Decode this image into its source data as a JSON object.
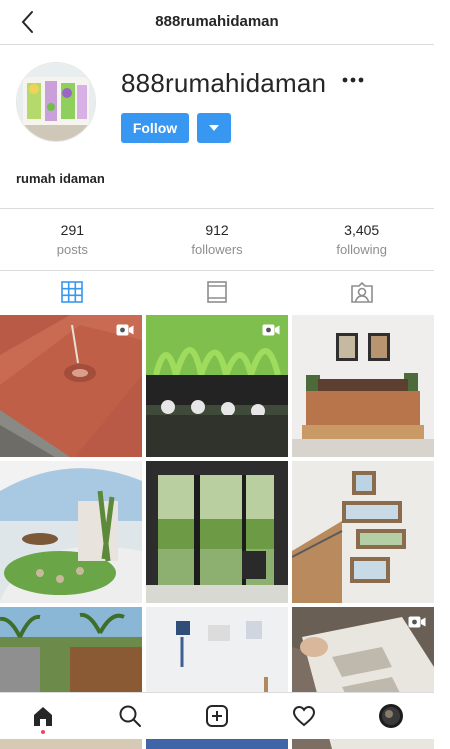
{
  "header": {
    "title": "888rumahidaman"
  },
  "profile": {
    "username": "888rumahidaman",
    "follow_label": "Follow",
    "bio": "rumah idaman"
  },
  "stats": {
    "posts": {
      "value": "291",
      "label": "posts"
    },
    "followers": {
      "value": "912",
      "label": "followers"
    },
    "following": {
      "value": "3,405",
      "label": "following"
    }
  },
  "tabs": {
    "active": "grid"
  },
  "grid": {
    "posts": [
      {
        "scene": "tiles",
        "video": true
      },
      {
        "scene": "hydroponic",
        "video": true
      },
      {
        "scene": "bedroom",
        "video": false
      },
      {
        "scene": "garden-curve",
        "video": false
      },
      {
        "scene": "glass-patio",
        "video": false
      },
      {
        "scene": "stair-window",
        "video": false
      },
      {
        "scene": "pool",
        "video": false
      },
      {
        "scene": "blue-bedroom",
        "video": false
      },
      {
        "scene": "wall-panel",
        "video": true
      }
    ]
  },
  "colors": {
    "accent": "#3897f0",
    "border": "#dbdbdb",
    "muted": "#8e8e8e",
    "notification": "#ed4956"
  }
}
